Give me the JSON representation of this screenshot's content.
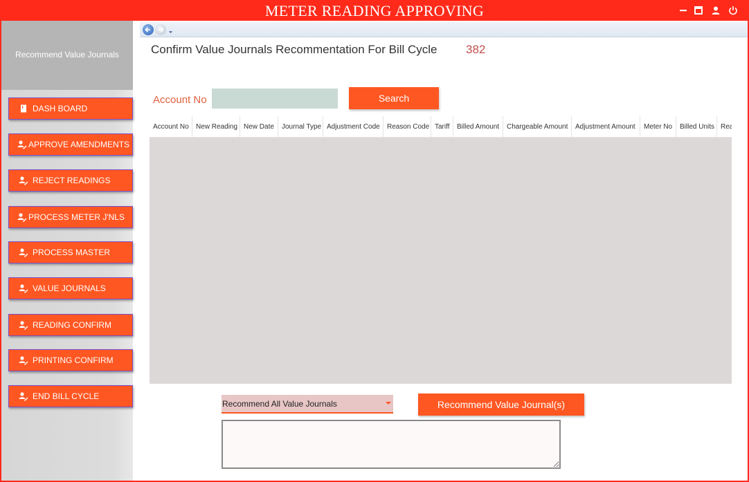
{
  "window": {
    "title": "METER READING APPROVING",
    "controls": [
      "minimize-icon",
      "maximize-icon",
      "user-icon",
      "power-icon"
    ],
    "accent": "#ff2a1a"
  },
  "sidebar": {
    "header": "Recommend Value Journals",
    "items": [
      {
        "label": "DASH BOARD",
        "icon": "dashboard-icon"
      },
      {
        "label": "APPROVE AMENDMENTS",
        "icon": "user-edit-icon"
      },
      {
        "label": "REJECT READINGS",
        "icon": "user-edit-icon"
      },
      {
        "label": "PROCESS METER J'NLS",
        "icon": "user-edit-icon"
      },
      {
        "label": "PROCESS MASTER",
        "icon": "user-edit-icon"
      },
      {
        "label": "VALUE JOURNALS",
        "icon": "user-edit-icon"
      },
      {
        "label": "READING CONFIRM",
        "icon": "user-edit-icon"
      },
      {
        "label": "PRINTING CONFIRM",
        "icon": "user-edit-icon"
      },
      {
        "label": "END BILL CYCLE",
        "icon": "user-edit-icon"
      }
    ],
    "button_color": "#ff5722"
  },
  "main": {
    "title": "Confirm Value Journals Recommentation For Bill Cycle",
    "bill_cycle": "382",
    "search": {
      "label": "Account No",
      "value": "",
      "button": "Search"
    },
    "grid": {
      "columns": [
        "Account No",
        "New Reading",
        "New Date",
        "Journal Type",
        "Adjustment Code",
        "Reason Code",
        "Tariff",
        "Billed Amount",
        "Chargeable Amount",
        "Adjustment Amount",
        "Meter No",
        "Billed Units",
        "Rea"
      ],
      "rows": []
    },
    "footer": {
      "select_value": "Recommend All Value Journals",
      "recommend_button": "Recommend Value Journal(s)",
      "remarks_value": ""
    }
  }
}
